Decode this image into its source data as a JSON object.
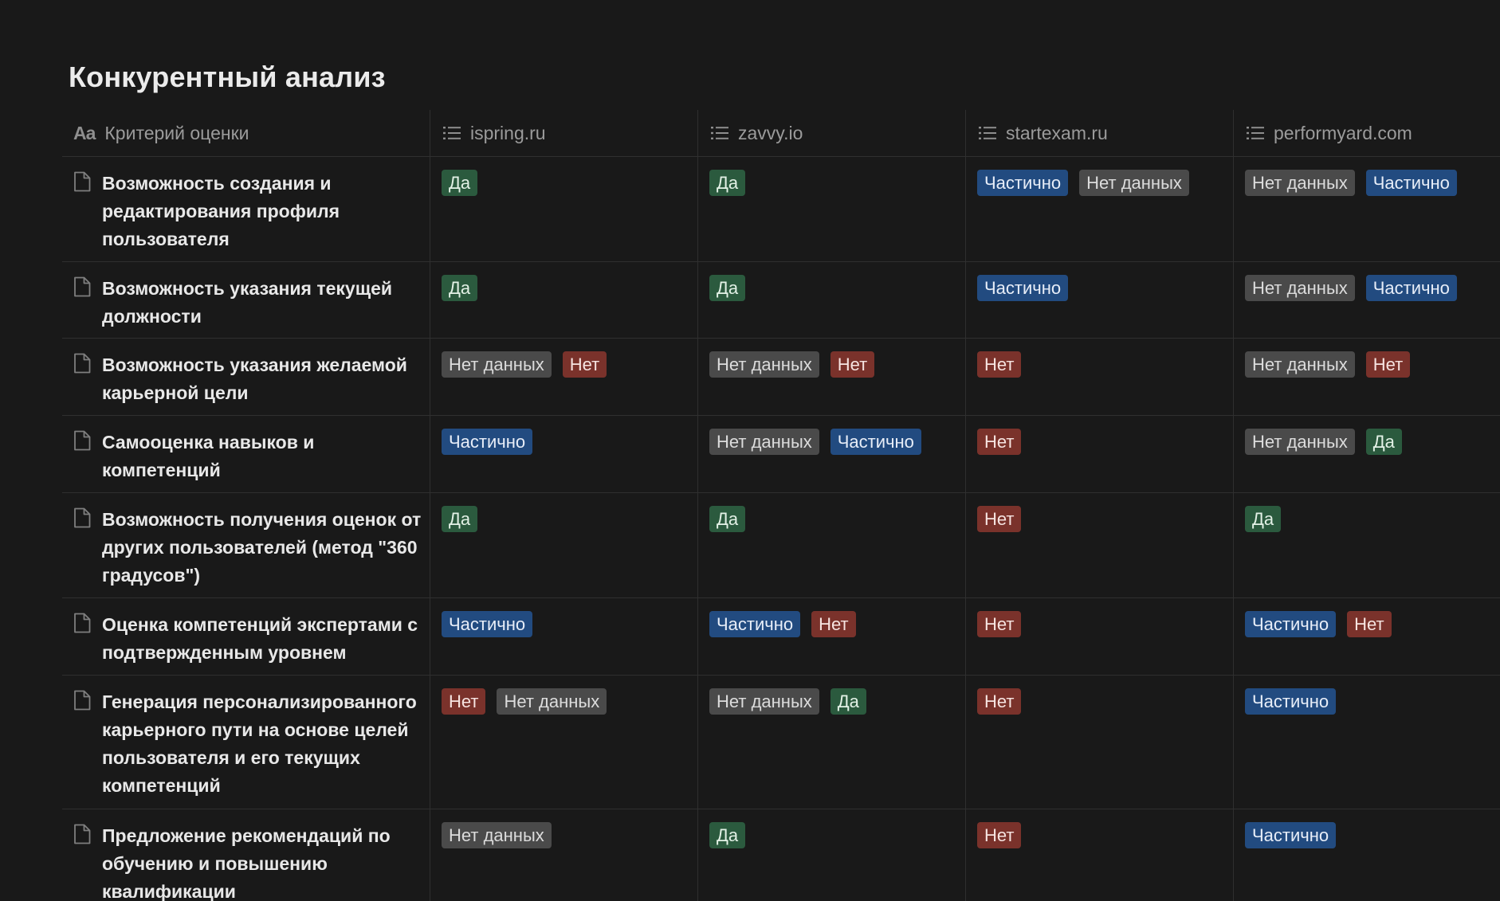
{
  "page_title": "Конкурентный анализ",
  "columns": [
    {
      "label": "Критерий оценки",
      "icon": "text-property-icon"
    },
    {
      "label": "ispring.ru",
      "icon": "list-icon"
    },
    {
      "label": "zavvy.io",
      "icon": "list-icon"
    },
    {
      "label": "startexam.ru",
      "icon": "list-icon"
    },
    {
      "label": "performyard.com",
      "icon": "list-icon"
    }
  ],
  "header_icon_text": "Aa",
  "tag_colors": {
    "Да": "green",
    "Частично": "blue",
    "Нет": "red",
    "Нет данных": "gray"
  },
  "rows": [
    {
      "criterion": "Возможность создания и редактирования профиля пользователя",
      "values": [
        [
          "Да"
        ],
        [
          "Да"
        ],
        [
          "Частично",
          "Нет данных"
        ],
        [
          "Нет данных",
          "Частично"
        ]
      ]
    },
    {
      "criterion": "Возможность указания текущей должности",
      "values": [
        [
          "Да"
        ],
        [
          "Да"
        ],
        [
          "Частично"
        ],
        [
          "Нет данных",
          "Частично"
        ]
      ]
    },
    {
      "criterion": "Возможность указания желаемой карьерной цели",
      "values": [
        [
          "Нет данных",
          "Нет"
        ],
        [
          "Нет данных",
          "Нет"
        ],
        [
          "Нет"
        ],
        [
          "Нет данных",
          "Нет"
        ]
      ]
    },
    {
      "criterion": "Самооценка навыков и компетенций",
      "values": [
        [
          "Частично"
        ],
        [
          "Нет данных",
          "Частично"
        ],
        [
          "Нет"
        ],
        [
          "Нет данных",
          "Да"
        ]
      ]
    },
    {
      "criterion": "Возможность получения оценок от других пользователей (метод \"360 градусов\")",
      "values": [
        [
          "Да"
        ],
        [
          "Да"
        ],
        [
          "Нет"
        ],
        [
          "Да"
        ]
      ]
    },
    {
      "criterion": "Оценка компетенций экспертами с подтвержденным уровнем",
      "values": [
        [
          "Частично"
        ],
        [
          "Частично",
          "Нет"
        ],
        [
          "Нет"
        ],
        [
          "Частично",
          "Нет"
        ]
      ]
    },
    {
      "criterion": "Генерация персонализированного карьерного пути на основе целей пользователя и его текущих компетенций",
      "values": [
        [
          "Нет",
          "Нет данных"
        ],
        [
          "Нет данных",
          "Да"
        ],
        [
          "Нет"
        ],
        [
          "Частично"
        ]
      ]
    },
    {
      "criterion": "Предложение рекомендаций по обучению и повышению квалификации",
      "values": [
        [
          "Нет данных"
        ],
        [
          "Да"
        ],
        [
          "Нет"
        ],
        [
          "Частично"
        ]
      ]
    }
  ]
}
